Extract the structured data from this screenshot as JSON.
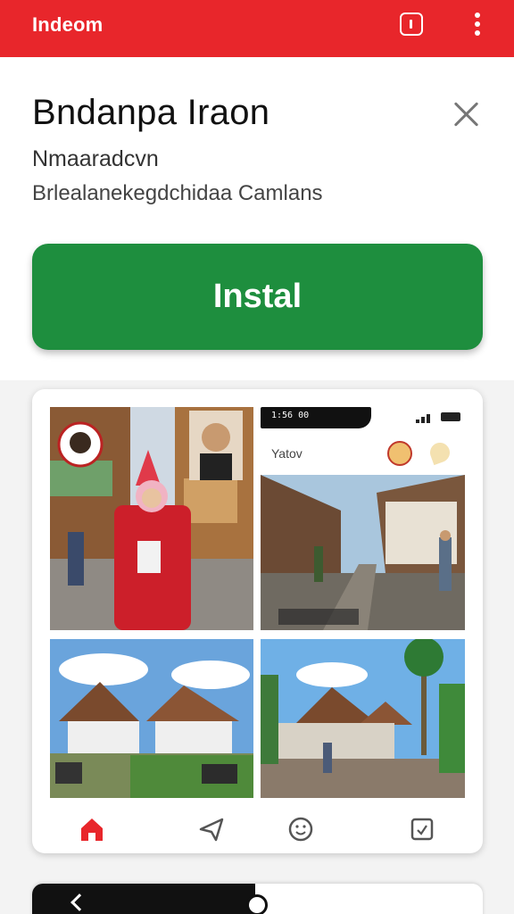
{
  "topbar": {
    "title": "Indeom",
    "icons": [
      "square-info-icon",
      "more-vert-icon"
    ]
  },
  "app": {
    "name": "Bndanpa Iraon",
    "developer": "Nmaaradcvn",
    "category": "Brlealanekegdchidaa Camlans",
    "install_label": "Instal"
  },
  "screenshot": {
    "status_time": "1:56 00",
    "label": "Yatov",
    "bottom_nav": [
      "home-icon",
      "share-icon",
      "smile-icon",
      "box-check-icon"
    ]
  },
  "colors": {
    "topbar": "#e8262b",
    "install": "#1e8e3e",
    "nav_active": "#e8262b"
  }
}
